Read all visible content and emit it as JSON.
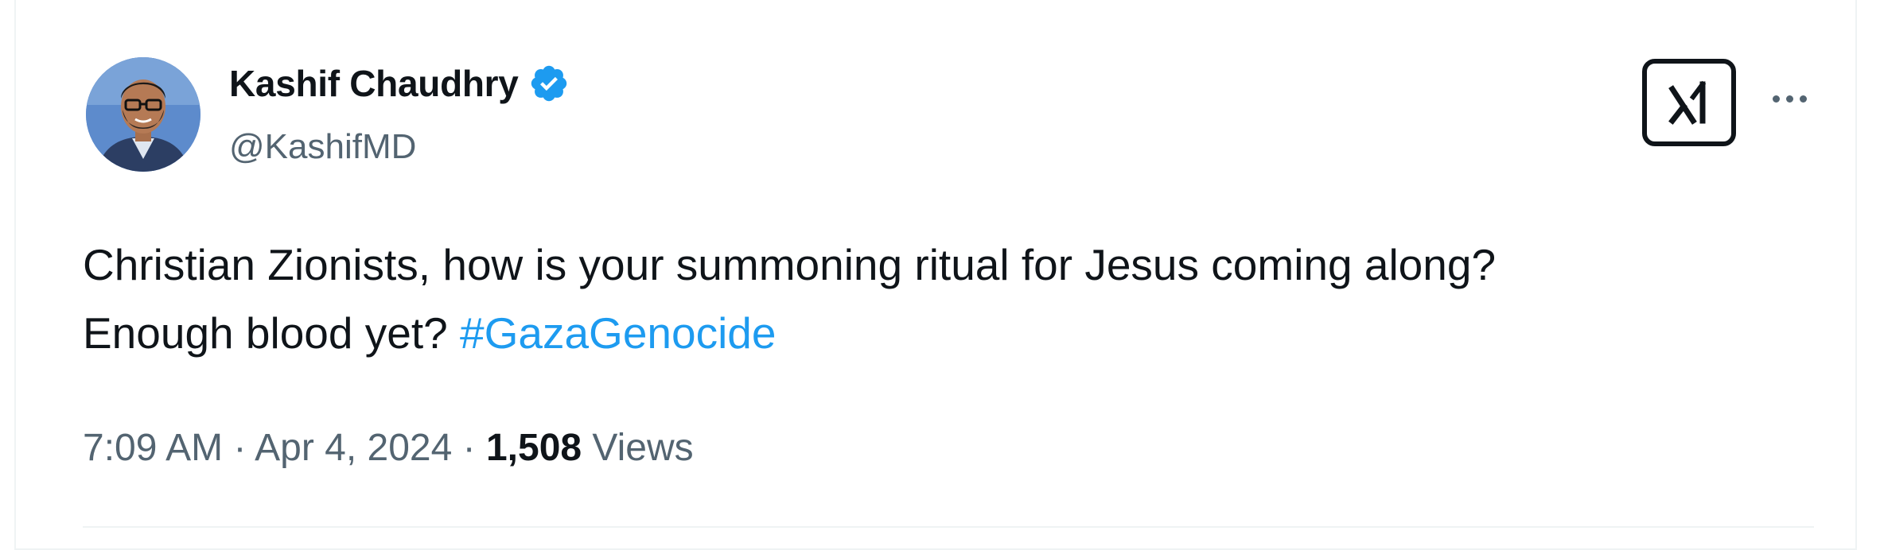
{
  "author": {
    "display_name": "Kashif Chaudhry",
    "handle": "@KashifMD",
    "verified": true,
    "verified_color": "#1d9bf0"
  },
  "toolbar": {
    "grok_icon": "grok-icon",
    "more_icon": "more-options-icon"
  },
  "tweet": {
    "line1": "Christian Zionists, how is your summoning ritual for Jesus coming along?",
    "line2_prefix": "Enough blood yet? ",
    "hashtag": "#GazaGenocide",
    "hashtag_color": "#1d9bf0"
  },
  "meta": {
    "time": "7:09 AM",
    "separator": " · ",
    "date": "Apr 4, 2024",
    "views_count": "1,508",
    "views_label": " Views"
  }
}
